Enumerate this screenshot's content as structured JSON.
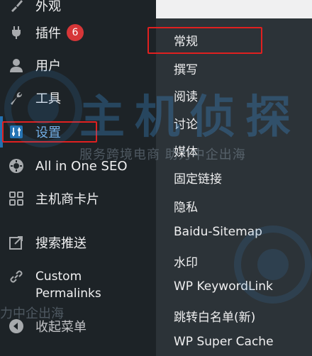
{
  "sidebar": {
    "items": [
      {
        "label": "外观",
        "icon": "paintbrush-icon"
      },
      {
        "label": "插件",
        "icon": "plugin-icon",
        "badge": "6"
      },
      {
        "label": "用户",
        "icon": "user-icon"
      },
      {
        "label": "工具",
        "icon": "wrench-icon"
      },
      {
        "label": "设置",
        "icon": "settings-sliders-icon"
      },
      {
        "label": "All in One SEO",
        "icon": "gear-icon"
      },
      {
        "label": "主机商卡片",
        "icon": "grid-icon"
      },
      {
        "label": "搜索推送",
        "icon": "external-box-icon"
      },
      {
        "label_line1": "Custom",
        "label_line2": "Permalinks",
        "icon": "link-icon"
      },
      {
        "label": "收起菜单",
        "icon": "collapse-icon"
      }
    ]
  },
  "submenu": {
    "items": [
      "常规",
      "撰写",
      "阅读",
      "讨论",
      "媒体",
      "固定链接",
      "隐私",
      "Baidu-Sitemap",
      "水印",
      "WP KeywordLink",
      "跳转白名单(新)",
      "WP Super Cache"
    ]
  },
  "watermark": {
    "big": "主机侦探",
    "small": "服务跨境电商 助力中企出海",
    "bottom": "力中企出海"
  },
  "colors": {
    "sidebar_bg": "#1d2327",
    "submenu_bg": "#2c3338",
    "accent": "#2271b1",
    "badge": "#d63638",
    "highlight": "#e02020"
  }
}
